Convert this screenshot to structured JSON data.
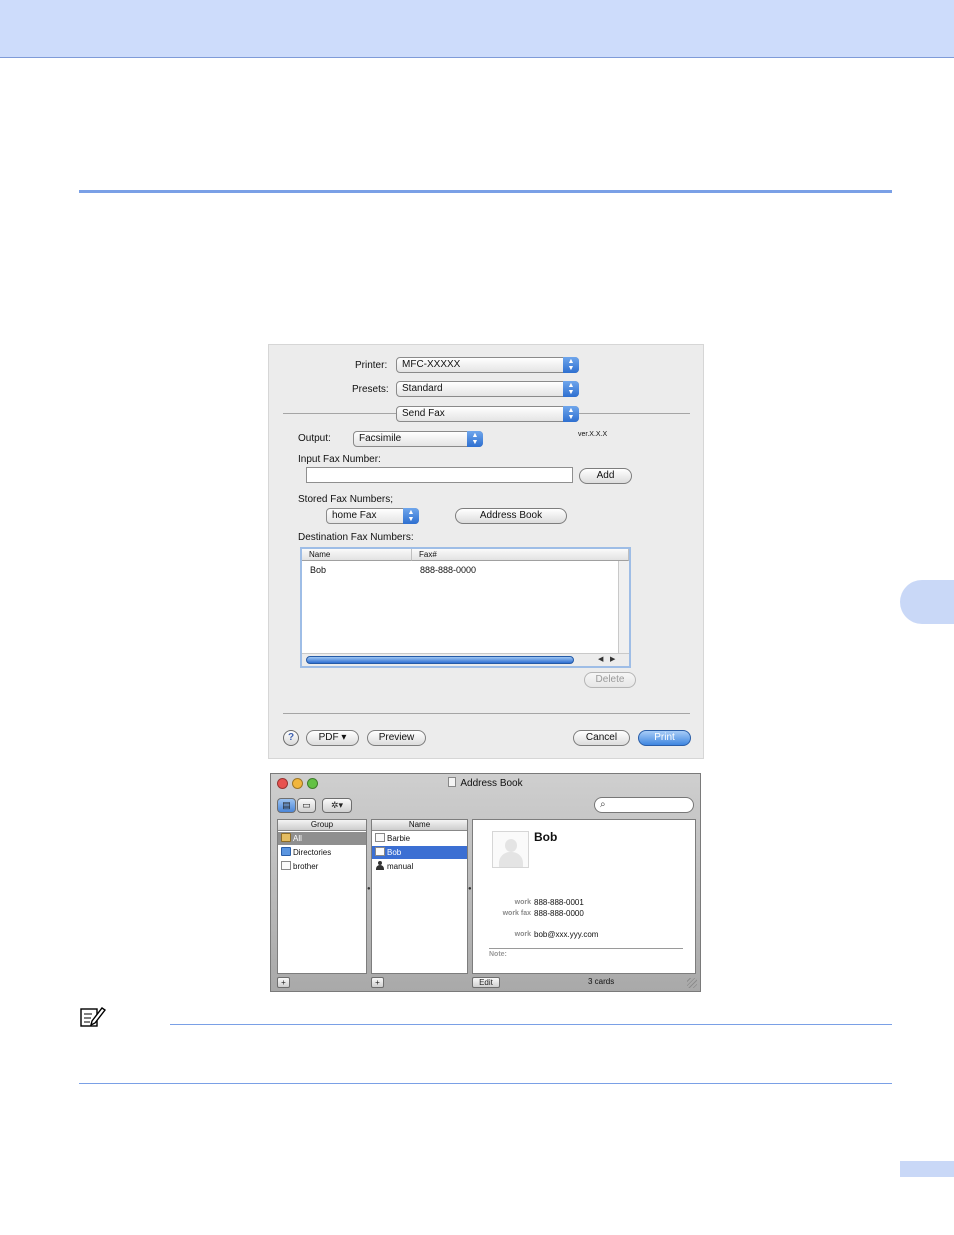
{
  "print_dialog": {
    "printer_label": "Printer:",
    "printer_value": "MFC-XXXXX",
    "presets_label": "Presets:",
    "presets_value": "Standard",
    "panel_value": "Send Fax",
    "output_label": "Output:",
    "output_value": "Facsimile",
    "version_text": "ver.X.X.X",
    "input_fax_label": "Input Fax Number:",
    "input_fax_value": "",
    "add_button": "Add",
    "stored_fax_label": "Stored Fax Numbers;",
    "stored_fax_value": "home Fax",
    "address_book_button": "Address Book",
    "destination_label": "Destination Fax Numbers:",
    "table": {
      "columns": [
        "Name",
        "Fax#"
      ],
      "rows": [
        {
          "name": "Bob",
          "fax": "888-888-0000"
        }
      ]
    },
    "delete_button": "Delete",
    "help_button": "?",
    "pdf_button": "PDF ▾",
    "preview_button": "Preview",
    "cancel_button": "Cancel",
    "print_button": "Print"
  },
  "address_book": {
    "title": "Address Book",
    "group_header": "Group",
    "groups": [
      "All",
      "Directories",
      "brother"
    ],
    "name_header": "Name",
    "names": [
      "Barbie",
      "Bob",
      "manual"
    ],
    "contact": {
      "name": "Bob",
      "fields": [
        {
          "label": "work",
          "value": "888-888-0001"
        },
        {
          "label": "work fax",
          "value": "888-888-0000"
        },
        {
          "label": "work",
          "value": "bob@xxx.yyy.com"
        }
      ],
      "note_label": "Note:"
    },
    "edit_button": "Edit",
    "add_symbol": "+",
    "card_count": "3 cards"
  },
  "colors": {
    "header_band": "#cddcfb",
    "rule": "#7aa0e6",
    "accent_blue": "#3b6fd3"
  }
}
